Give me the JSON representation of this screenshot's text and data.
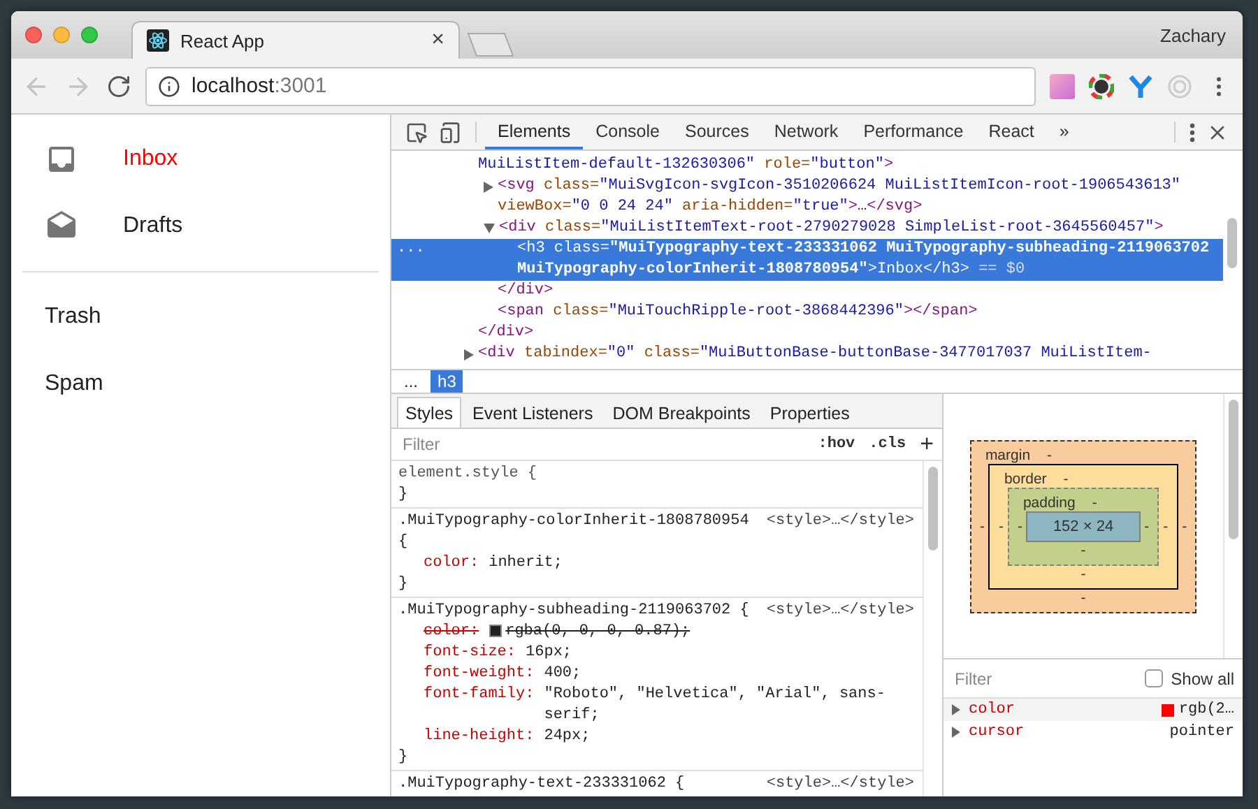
{
  "browser": {
    "tab": {
      "title": "React App",
      "close": "×"
    },
    "profile": "Zachary",
    "nav_buttons": [
      {
        "kind": "back",
        "disabled": true
      },
      {
        "kind": "forward",
        "disabled": true
      },
      {
        "kind": "reload",
        "disabled": false
      }
    ],
    "address": {
      "host": "localhost",
      "port": ":3001"
    }
  },
  "page": {
    "lists": [
      {
        "items": [
          {
            "label": "Inbox",
            "kind": "inbox",
            "selected": true
          },
          {
            "label": "Drafts",
            "kind": "drafts",
            "selected": false
          }
        ]
      },
      {
        "items": [
          {
            "label": "Trash",
            "kind": "text",
            "selected": false
          },
          {
            "label": "Spam",
            "kind": "text",
            "selected": false
          }
        ]
      }
    ]
  },
  "devtools": {
    "tabs": [
      {
        "label": "Elements",
        "selected": true
      },
      {
        "label": "Console",
        "selected": false
      },
      {
        "label": "Sources",
        "selected": false
      },
      {
        "label": "Network",
        "selected": false
      },
      {
        "label": "Performance",
        "selected": false
      },
      {
        "label": "React",
        "selected": false
      }
    ],
    "more": "»",
    "dom": [
      {
        "kind": "leaf",
        "selected": false,
        "parts": [
          {
            "kind": "value",
            "text": "MuiListItem-default-132630306\""
          },
          {
            "kind": "attr",
            "text": " role="
          },
          {
            "kind": "value",
            "text": "\"button\""
          },
          {
            "kind": "tag",
            "text": ">"
          }
        ],
        "children": [
          {
            "kind": "collapsed",
            "selected": false,
            "parts": [
              {
                "kind": "tag",
                "text": "<svg"
              },
              {
                "kind": "attr",
                "text": " class="
              },
              {
                "kind": "value",
                "text": "\"MuiSvgIcon-svgIcon-3510206624 MuiListItemIcon-root-1906543613\""
              },
              {
                "kind": "attr",
                "text": " viewBox="
              },
              {
                "kind": "value",
                "text": "\"0 0 24 24\""
              },
              {
                "kind": "attr",
                "text": " aria-hidden="
              },
              {
                "kind": "value",
                "text": "\"true\""
              },
              {
                "kind": "tag",
                "text": ">"
              },
              {
                "kind": "text",
                "text": "…"
              },
              {
                "kind": "tag",
                "text": "</svg>"
              }
            ]
          },
          {
            "kind": "expanded",
            "selected": false,
            "parts": [
              {
                "kind": "tag",
                "text": "<div"
              },
              {
                "kind": "attr",
                "text": " class="
              },
              {
                "kind": "value",
                "text": "\"MuiListItemText-root-2790279028 SimpleList-root-3645560457\""
              },
              {
                "kind": "tag",
                "text": ">"
              }
            ],
            "children": [
              {
                "kind": "leaf",
                "selected": true,
                "gutter": "...",
                "parts": [
                  {
                    "kind": "tag",
                    "text": "<h3"
                  },
                  {
                    "kind": "attr",
                    "text": " class="
                  },
                  {
                    "kind": "value",
                    "text": "\"MuiTypography-text-233331062 MuiTypography-subheading-2119063702 MuiTypography-colorInherit-1808780954\""
                  },
                  {
                    "kind": "tag",
                    "text": ">"
                  },
                  {
                    "kind": "text",
                    "text": "Inbox"
                  },
                  {
                    "kind": "tag",
                    "text": "</h3>"
                  },
                  {
                    "kind": "marker",
                    "text": " == $0"
                  }
                ]
              }
            ],
            "closing": [
              {
                "kind": "tag",
                "text": "</div>"
              }
            ]
          },
          {
            "kind": "leaf",
            "selected": false,
            "parts": [
              {
                "kind": "tag",
                "text": "<span"
              },
              {
                "kind": "attr",
                "text": " class="
              },
              {
                "kind": "value",
                "text": "\"MuiTouchRipple-root-3868442396\""
              },
              {
                "kind": "tag",
                "text": "></span>"
              }
            ]
          }
        ],
        "closing": [
          {
            "kind": "tag",
            "text": "</div>"
          }
        ]
      },
      {
        "kind": "collapsed",
        "selected": false,
        "parts": [
          {
            "kind": "tag",
            "text": "<div"
          },
          {
            "kind": "attr",
            "text": " tabindex="
          },
          {
            "kind": "value",
            "text": "\"0\""
          },
          {
            "kind": "attr",
            "text": " class="
          },
          {
            "kind": "value",
            "text": "\"MuiButtonBase-buttonBase-3477017037 MuiListItem-"
          }
        ]
      }
    ],
    "breadcrumbs": [
      {
        "label": "...",
        "selected": false
      },
      {
        "label": "h3",
        "selected": true
      }
    ],
    "sidebar_tabs": [
      {
        "label": "Styles",
        "selected": true
      },
      {
        "label": "Event Listeners",
        "selected": false
      },
      {
        "label": "DOM Breakpoints",
        "selected": false
      },
      {
        "label": "Properties",
        "selected": false
      }
    ],
    "styles_filter": {
      "placeholder": "Filter",
      "hov": ":hov",
      "cls": ".cls",
      "add": "+"
    },
    "rules": [
      {
        "kind": "inline",
        "selector": "element.style {",
        "closing": "}"
      },
      {
        "kind": "stylesheet",
        "selector": ".MuiTypography-colorInherit-1808780954 {",
        "source": "<style>…</style>",
        "declarations": [
          {
            "property": "color:",
            "value": "inherit;",
            "overridden": false
          }
        ],
        "closing": "}"
      },
      {
        "kind": "stylesheet",
        "selector": ".MuiTypography-subheading-2119063702 {",
        "source": "<style>…</style>",
        "declarations": [
          {
            "property": "color:",
            "value": "rgba(0, 0, 0, 0.87);",
            "overridden": true,
            "color": "#212121"
          },
          {
            "property": "font-size:",
            "value": "16px;",
            "overridden": false
          },
          {
            "property": "font-weight:",
            "value": "400;",
            "overridden": false
          },
          {
            "property": "font-family:",
            "value": "\"Roboto\", \"Helvetica\", \"Arial\", sans-serif;",
            "overridden": false
          },
          {
            "property": "line-height:",
            "value": "24px;",
            "overridden": false
          }
        ],
        "closing": "}"
      },
      {
        "kind": "stylesheet",
        "selector": ".MuiTypography-text-233331062 {",
        "source": "<style>…</style>"
      }
    ],
    "box_model": {
      "margin": {
        "label": "margin",
        "top": "-",
        "right": "-",
        "bottom": "-",
        "left": "-"
      },
      "border": {
        "label": "border",
        "top": "-",
        "right": "-",
        "bottom": "-",
        "left": "-"
      },
      "padding": {
        "label": "padding",
        "top": "-",
        "right": "-",
        "bottom": "-",
        "left": "-"
      },
      "content": "152 × 24"
    },
    "computed_filter": {
      "placeholder": "Filter",
      "show_all": {
        "label": "Show all",
        "checked": false
      }
    },
    "computed": [
      {
        "property": "color",
        "value": "rgb(2…",
        "color": "#ff0000"
      },
      {
        "property": "cursor",
        "value": "pointer"
      }
    ]
  }
}
